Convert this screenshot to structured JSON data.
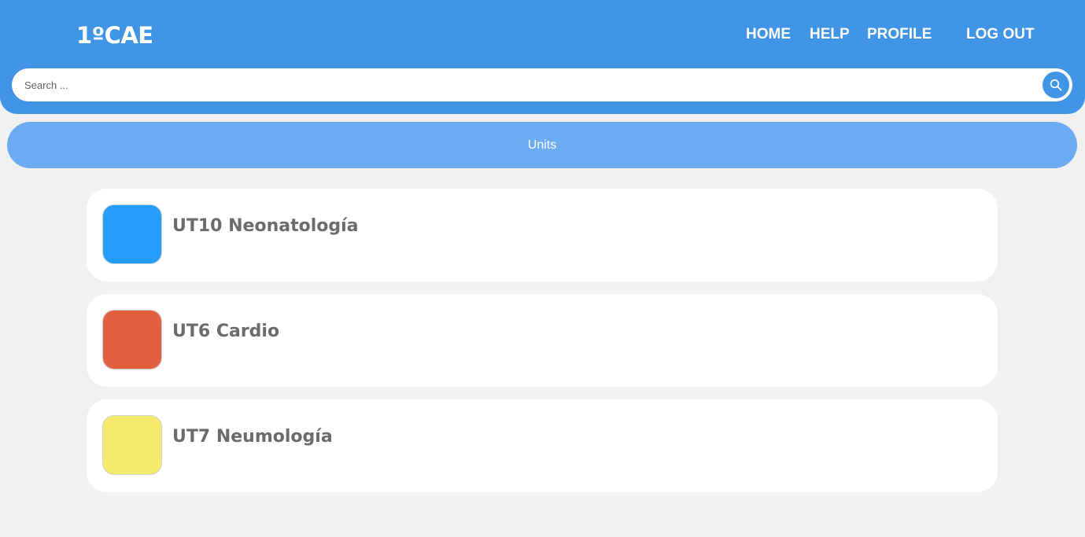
{
  "header": {
    "brand": "1ºCAE",
    "nav": {
      "home": "HOME",
      "help": "HELP",
      "profile": "PROFILE",
      "logout": "LOG OUT"
    },
    "search": {
      "placeholder": "Search ...",
      "icon": "search-icon"
    },
    "colors": {
      "header_bg": "#4195e6",
      "units_bg": "#6aabf2"
    }
  },
  "section": {
    "title": "Units"
  },
  "units": [
    {
      "title": "UT10 Neonatología",
      "color": "#259dfd"
    },
    {
      "title": "UT6 Cardio",
      "color": "#e35f3f"
    },
    {
      "title": "UT7 Neumología",
      "color": "#f4ea6c"
    }
  ]
}
